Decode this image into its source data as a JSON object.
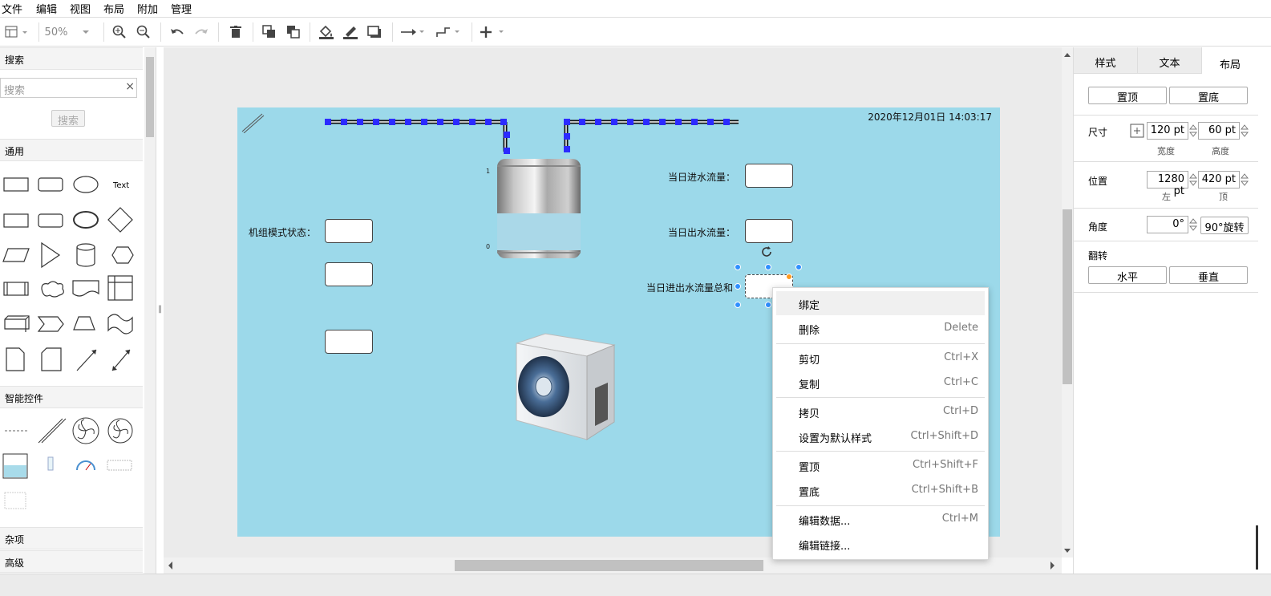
{
  "menu": {
    "items": [
      "文件",
      "编辑",
      "视图",
      "布局",
      "附加",
      "管理"
    ]
  },
  "toolbar": {
    "zoom": "50%"
  },
  "left": {
    "search_section": "搜索",
    "search_placeholder": "搜索",
    "search_button": "搜索",
    "general_section": "通用",
    "text_shape": "Text",
    "smart_section": "智能控件",
    "misc_section": "杂项",
    "advanced_section": "高级"
  },
  "diagram": {
    "timestamp": "2020年12月01日 14:03:17",
    "in_flow_label": "当日进水流量：",
    "out_flow_label": "当日出水流量：",
    "total_flow_label": "当日进出水流量总和",
    "mode_label": "机组模式状态：",
    "tank_top": "1",
    "tank_bottom": "0"
  },
  "context_menu": {
    "items": [
      {
        "label": "绑定",
        "key": ""
      },
      {
        "label": "删除",
        "key": "Delete"
      },
      {
        "label": "剪切",
        "key": "Ctrl+X"
      },
      {
        "label": "复制",
        "key": "Ctrl+C"
      },
      {
        "label": "拷贝",
        "key": "Ctrl+D"
      },
      {
        "label": "设置为默认样式",
        "key": "Ctrl+Shift+D"
      },
      {
        "label": "置顶",
        "key": "Ctrl+Shift+F"
      },
      {
        "label": "置底",
        "key": "Ctrl+Shift+B"
      },
      {
        "label": "编辑数据...",
        "key": "Ctrl+M"
      },
      {
        "label": "编辑链接...",
        "key": ""
      }
    ]
  },
  "right": {
    "tabs": [
      "样式",
      "文本",
      "布局"
    ],
    "to_front": "置顶",
    "to_back": "置底",
    "size_label": "尺寸",
    "width_value": "120 pt",
    "height_value": "60 pt",
    "width_label": "宽度",
    "height_label": "高度",
    "position_label": "位置",
    "left_value": "1280 pt",
    "top_value": "420 pt",
    "left_label": "左",
    "top_label": "顶",
    "angle_label": "角度",
    "angle_value": "0°",
    "rotate_button": "90°旋转",
    "flip_label": "翻转",
    "flip_h": "水平",
    "flip_v": "垂直"
  },
  "colors": {
    "canvas": "#9cd9ea",
    "selection": "#2f8fff",
    "pipe_dot": "#2b2bff"
  }
}
